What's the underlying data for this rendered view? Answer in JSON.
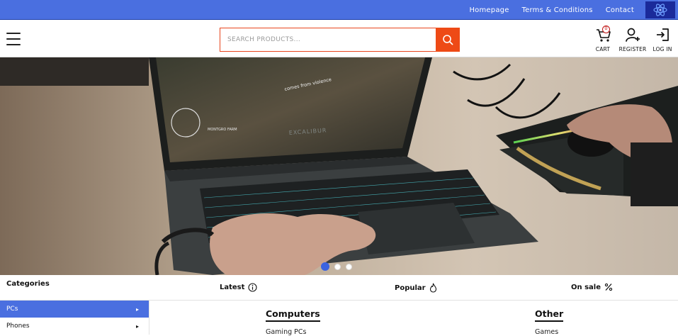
{
  "topbar": {
    "links": [
      "Homepage",
      "Terms & Conditions",
      "Contact"
    ],
    "flag_icon": "eu-flag-icon",
    "color": "#4a6fe0"
  },
  "header": {
    "menu_icon": "hamburger-menu-icon",
    "search": {
      "placeholder": "SEARCH PRODUCTS...",
      "value": "",
      "button_icon": "search-icon",
      "accent": "#ee4a16"
    },
    "cart": {
      "label": "CART",
      "count": "0",
      "icon": "cart-icon"
    },
    "register": {
      "label": "REGISTER",
      "icon": "user-plus-icon"
    },
    "login": {
      "label": "LOG IN",
      "icon": "login-icon"
    }
  },
  "hero": {
    "screen_text": "comes from violence",
    "map_text": "MONTGRO FARM",
    "laptop_brand": "EXCALIBUR",
    "slides": 3,
    "active_slide": 1
  },
  "categories": {
    "title": "Categories",
    "items": [
      {
        "label": "PCs",
        "active": true
      },
      {
        "label": "Phones",
        "active": false
      }
    ]
  },
  "tabs": [
    {
      "label": "Latest",
      "icon": "info-icon"
    },
    {
      "label": "Popular",
      "icon": "flame-icon"
    },
    {
      "label": "On sale",
      "icon": "percent-icon"
    }
  ],
  "columns": [
    {
      "title": "Computers",
      "items": [
        "Gaming PCs"
      ]
    },
    {
      "title": "Other",
      "items": [
        "Games"
      ]
    }
  ]
}
